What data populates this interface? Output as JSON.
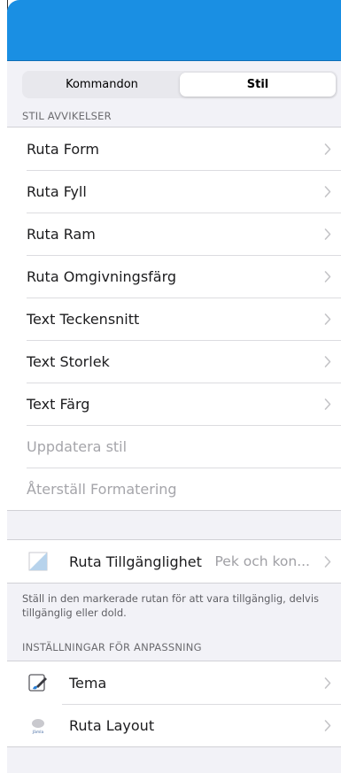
{
  "colors": {
    "top_bar": "#1a8fe3",
    "background": "#f2f2f7",
    "disabled_text": "#a5a5aa",
    "chevron": "#c4c4c7"
  },
  "segment": {
    "tabs": [
      {
        "label": "Kommandon",
        "active": false
      },
      {
        "label": "Stil",
        "active": true
      }
    ]
  },
  "style_section": {
    "header": "STIL AVVIKELSER",
    "items": [
      {
        "label": "Ruta Form",
        "chevron": true,
        "enabled": true
      },
      {
        "label": "Ruta Fyll",
        "chevron": true,
        "enabled": true
      },
      {
        "label": "Ruta Ram",
        "chevron": true,
        "enabled": true
      },
      {
        "label": "Ruta Omgivningsfärg",
        "chevron": true,
        "enabled": true
      },
      {
        "label": "Text Teckensnitt",
        "chevron": true,
        "enabled": true
      },
      {
        "label": "Text Storlek",
        "chevron": true,
        "enabled": true
      },
      {
        "label": "Text Färg",
        "chevron": true,
        "enabled": true
      },
      {
        "label": "Uppdatera stil",
        "chevron": false,
        "enabled": false
      },
      {
        "label": "Återställ Formatering",
        "chevron": false,
        "enabled": false
      }
    ]
  },
  "accessibility": {
    "label": "Ruta Tillgänglighet",
    "value": "Pek och kon...",
    "icon": "triangle-half-icon",
    "footnote": "Ställ in den markerade rutan för att vara tillgänglig, delvis tillgänglig eller dold."
  },
  "customization_section": {
    "header": "INSTÄLLNINGAR FÖR ANPASSNING",
    "items": [
      {
        "label": "Tema",
        "icon": "paint-brush-icon"
      },
      {
        "label": "Ruta Layout",
        "icon": "cell-layout-icon",
        "icon_caption": "Jämla"
      }
    ]
  }
}
